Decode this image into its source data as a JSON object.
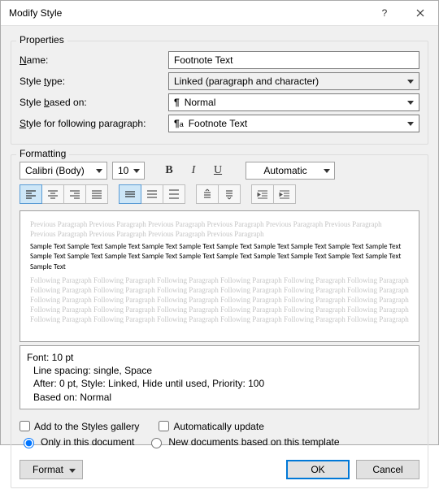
{
  "window": {
    "title": "Modify Style"
  },
  "properties": {
    "legend": "Properties",
    "name_label": "Name:",
    "name_value": "Footnote Text",
    "type_label": "Style type:",
    "type_value": "Linked (paragraph and character)",
    "based_label": "Style based on:",
    "based_value": "Normal",
    "following_label": "Style for following paragraph:",
    "following_value": "Footnote Text"
  },
  "formatting": {
    "legend": "Formatting",
    "font_name": "Calibri (Body)",
    "font_size": "10",
    "color": "Automatic",
    "preview_prev": "Previous Paragraph Previous Paragraph Previous Paragraph Previous Paragraph Previous Paragraph Previous Paragraph Previous Paragraph Previous Paragraph Previous Paragraph Previous Paragraph",
    "preview_sample": "Sample Text Sample Text Sample Text Sample Text Sample Text Sample Text Sample Text Sample Text Sample Text Sample Text Sample Text Sample Text Sample Text Sample Text Sample Text Sample Text Sample Text Sample Text Sample Text Sample Text Sample Text",
    "preview_next": "Following Paragraph Following Paragraph Following Paragraph Following Paragraph Following Paragraph Following Paragraph Following Paragraph Following Paragraph Following Paragraph Following Paragraph Following Paragraph Following Paragraph Following Paragraph Following Paragraph Following Paragraph Following Paragraph Following Paragraph Following Paragraph Following Paragraph Following Paragraph Following Paragraph Following Paragraph Following Paragraph Following Paragraph Following Paragraph Following Paragraph Following Paragraph Following Paragraph Following Paragraph Following Paragraph",
    "desc_l1": "Font: 10 pt",
    "desc_l2": "Line spacing:  single, Space",
    "desc_l3": "After:  0 pt, Style: Linked, Hide until used, Priority: 100",
    "desc_l4": "Based on: Normal"
  },
  "options": {
    "add_gallery": "Add to the Styles gallery",
    "auto_update": "Automatically update",
    "only_doc": "Only in this document",
    "new_docs": "New documents based on this template"
  },
  "buttons": {
    "format": "Format",
    "ok": "OK",
    "cancel": "Cancel"
  }
}
